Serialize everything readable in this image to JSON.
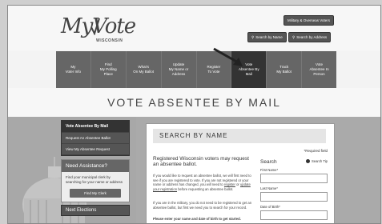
{
  "header": {
    "logo_text": "MyVote",
    "logo_subtitle": "WISCONSIN",
    "buttons": {
      "military": "Military & Overseas Voters",
      "search_by_name": "Search by Name",
      "search_by_address": "Search by Address"
    }
  },
  "nav": {
    "items": [
      {
        "label": "My\nVoter Info"
      },
      {
        "label": "Find\nMy Polling\nPlace"
      },
      {
        "label": "What's\nOn My Ballot"
      },
      {
        "label": "Update\nMy Name or\nAddress"
      },
      {
        "label": "Register\nTo Vote"
      },
      {
        "label": "Vote\nAbsentee By\nMail"
      },
      {
        "label": "Track\nMy Ballot"
      },
      {
        "label": "Vote\nAbsentee In\nPerson"
      }
    ],
    "active_index": 5
  },
  "page_title": "VOTE ABSENTEE BY MAIL",
  "sidebar": {
    "links": [
      "Vote Absentee By Mail",
      "Request An Absentee Ballot",
      "View My Absentee Request"
    ],
    "assistance_title": "Need Assistance?",
    "assistance_text": "Find your municipal clerk by searching for your name or address",
    "find_clerk_button": "Find My Clerk",
    "next_title": "Next Elections"
  },
  "main": {
    "section_title": "SEARCH BY NAME",
    "required_note": "*Required field",
    "intro": "Registered Wisconsin voters may request an absentee ballot.",
    "para1_before": "If you would like to request an absentee ballot, we will first need to see if you are registered to vote. If you are not registered or your name or address has changed, you will need to ",
    "para1_link1": "register",
    "para1_mid": " or ",
    "para1_link2": "update your registration",
    "para1_after": " before requesting an absentee ballot.",
    "para2": "If you are in the military, you do not need to be registered to get an absentee ballot, but first we need you to search for your record.",
    "para3": "Please enter your name and date of birth to get started."
  },
  "search_form": {
    "title": "Search",
    "tip_label": "Search Tip",
    "first_name_label": "First Name*",
    "last_name_label": "Last Name*",
    "dob_label": "Date of Birth*"
  },
  "colors": {
    "nav_bg": "#666666",
    "nav_active_bg": "#333333",
    "panel_bg": "#ffffff",
    "title_bar": "#e5e5e5"
  }
}
